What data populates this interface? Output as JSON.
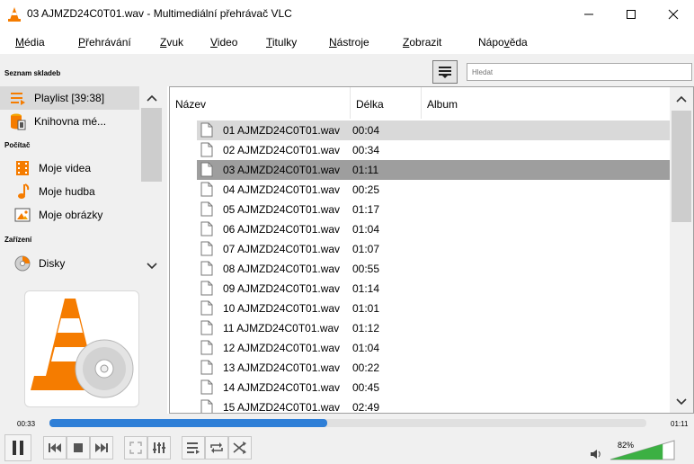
{
  "window": {
    "title": "03 AJMZD24C0T01.wav - Multimediální přehrávač VLC"
  },
  "menu": [
    {
      "label": "Média",
      "underline": "M",
      "rest": "édia"
    },
    {
      "label": "Přehrávání",
      "underline": "P",
      "rest": "řehrávání"
    },
    {
      "label": "Zvuk",
      "underline": "Z",
      "rest": "vuk"
    },
    {
      "label": "Video",
      "underline": "V",
      "rest": "ideo"
    },
    {
      "label": "Titulky",
      "underline": "T",
      "rest": "itulky"
    },
    {
      "label": "Nástroje",
      "underline": "N",
      "rest": "ástroje"
    },
    {
      "label": "Zobrazit",
      "underline": "Z",
      "rest": "obrazit"
    },
    {
      "label": "Nápověda",
      "pre": "Nápo",
      "underline": "v",
      "rest": "ěda"
    }
  ],
  "sidebar": {
    "section_playlist": "Seznam skladeb",
    "playlist_label": "Playlist [39:38]",
    "library_label": "Knihovna mé...",
    "section_computer": "Počítač",
    "videos_label": "Moje videa",
    "music_label": "Moje hudba",
    "pictures_label": "Moje obrázky",
    "section_devices": "Zařízení",
    "discs_label": "Disky"
  },
  "search": {
    "placeholder": "Hledat"
  },
  "table": {
    "headers": {
      "name": "Název",
      "duration": "Délka",
      "album": "Album"
    },
    "rows": [
      {
        "name": "01 AJMZD24C0T01.wav",
        "duration": "00:04"
      },
      {
        "name": "02 AJMZD24C0T01.wav",
        "duration": "00:34"
      },
      {
        "name": "03 AJMZD24C0T01.wav",
        "duration": "01:11"
      },
      {
        "name": "04 AJMZD24C0T01.wav",
        "duration": "00:25"
      },
      {
        "name": "05 AJMZD24C0T01.wav",
        "duration": "01:17"
      },
      {
        "name": "06 AJMZD24C0T01.wav",
        "duration": "01:04"
      },
      {
        "name": "07 AJMZD24C0T01.wav",
        "duration": "01:07"
      },
      {
        "name": "08 AJMZD24C0T01.wav",
        "duration": "00:55"
      },
      {
        "name": "09 AJMZD24C0T01.wav",
        "duration": "01:14"
      },
      {
        "name": "10 AJMZD24C0T01.wav",
        "duration": "01:01"
      },
      {
        "name": "11 AJMZD24C0T01.wav",
        "duration": "01:12"
      },
      {
        "name": "12 AJMZD24C0T01.wav",
        "duration": "01:04"
      },
      {
        "name": "13 AJMZD24C0T01.wav",
        "duration": "00:22"
      },
      {
        "name": "14 AJMZD24C0T01.wav",
        "duration": "00:45"
      },
      {
        "name": "15 AJMZD24C0T01.wav",
        "duration": "02:49"
      }
    ],
    "selected_light_index": 0,
    "selected_dark_index": 2
  },
  "player": {
    "elapsed": "00:33",
    "total": "01:11",
    "progress_fraction": 0.465,
    "volume": "82%",
    "volume_fraction": 0.82
  },
  "colors": {
    "accent_blue": "#2f7fd7",
    "volume_green": "#3cb043",
    "vlc_orange": "#f57c00"
  }
}
